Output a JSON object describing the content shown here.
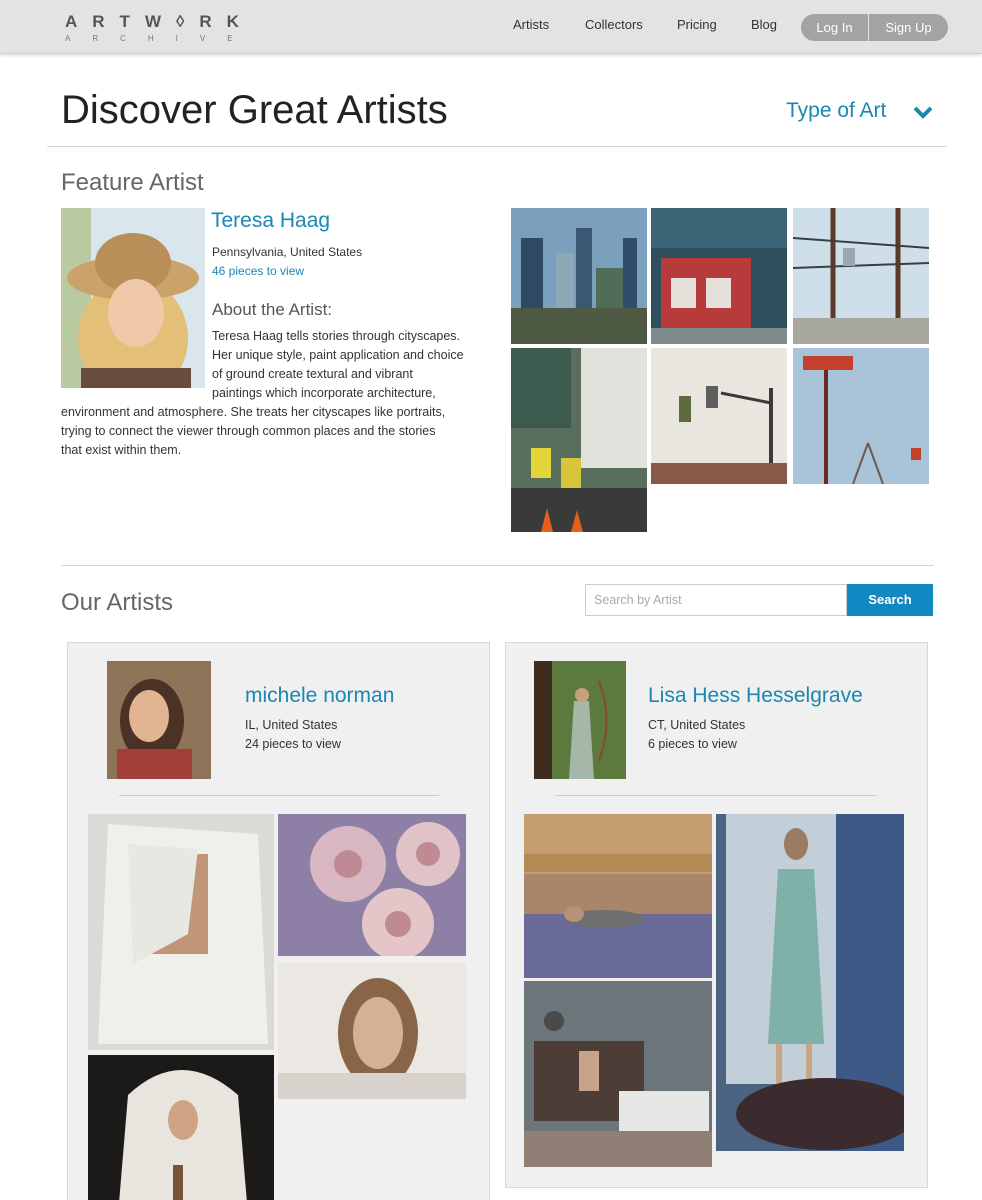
{
  "header": {
    "logo_top": "ARTW◊RK",
    "logo_bottom": "ARCHIVE",
    "nav": [
      "Artists",
      "Collectors",
      "Pricing",
      "Blog"
    ],
    "login": "Log In",
    "signup": "Sign Up"
  },
  "page": {
    "title": "Discover Great Artists",
    "type_of_art": "Type of Art"
  },
  "feature": {
    "heading": "Feature Artist",
    "name": "Teresa Haag",
    "location": "Pennsylvania, United States",
    "pieces": "46 pieces to view",
    "about_heading": "About the Artist:",
    "bio_lines": [
      "Teresa Haag tells stories through cityscapes.",
      "Her unique style, paint application and choice",
      "of ground create textural and vibrant",
      "paintings which incorporate architecture,",
      "environment and atmosphere. She treats her cityscapes like portraits,",
      "trying to connect the viewer through common places and the stories",
      "that exist within them."
    ]
  },
  "artists": {
    "heading": "Our Artists",
    "search_placeholder": "Search by Artist",
    "search_button": "Search",
    "cards": [
      {
        "name": "michele norman",
        "location": "IL, United States",
        "pieces": "24 pieces to view"
      },
      {
        "name": "Lisa Hess Hesselgrave",
        "location": "CT, United States",
        "pieces": "6 pieces to view"
      }
    ]
  },
  "colors": {
    "accent": "#1a87b5",
    "search_button": "#1288c2",
    "header_bg": "#e3e3e3"
  }
}
